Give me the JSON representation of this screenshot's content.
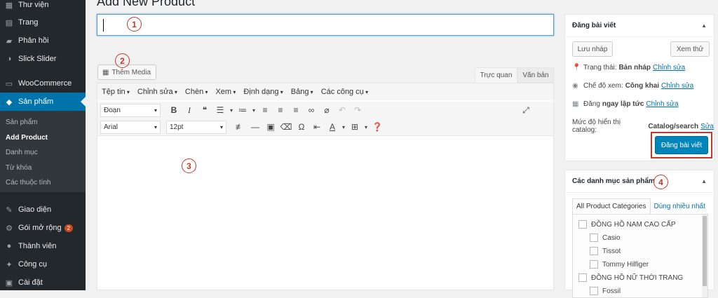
{
  "sidebar": {
    "items_top": [
      {
        "label": "Thư viện",
        "icon": "media-icon"
      },
      {
        "label": "Trang",
        "icon": "page-icon"
      },
      {
        "label": "Phản hồi",
        "icon": "comments-icon"
      },
      {
        "label": "Slick Slider",
        "icon": "slider-icon"
      }
    ],
    "woocommerce": "WooCommerce",
    "products": "Sản phẩm",
    "submenu": [
      "Sản phẩm",
      "Add Product",
      "Danh mục",
      "Từ khóa",
      "Các thuộc tính"
    ],
    "items_bottom": [
      {
        "label": "Giao diện",
        "icon": "appearance-icon"
      },
      {
        "label": "Gói mở rộng",
        "icon": "plugins-icon",
        "badge": "2"
      },
      {
        "label": "Thành viên",
        "icon": "users-icon"
      },
      {
        "label": "Công cụ",
        "icon": "tools-icon"
      },
      {
        "label": "Cài đặt",
        "icon": "settings-icon"
      }
    ]
  },
  "page_title": "Add New Product",
  "annotations": [
    "1",
    "2",
    "3",
    "4"
  ],
  "editor": {
    "add_media": "Thêm Media",
    "tabs": [
      "Trực quan",
      "Văn bản"
    ],
    "menubar": [
      "Tệp tin",
      "Chỉnh sửa",
      "Chèn",
      "Xem",
      "Định dạng",
      "Bảng",
      "Các công cụ"
    ],
    "format_select": "Đoạn",
    "font_select": "Arial",
    "size_select": "12pt"
  },
  "publish": {
    "title": "Đăng bài viết",
    "save_draft": "Lưu nháp",
    "preview": "Xem thử",
    "status_label": "Trạng thái:",
    "status_value": "Bản nháp",
    "visibility_label": "Chế độ xem:",
    "visibility_value": "Công khai",
    "schedule_label": "Đăng",
    "schedule_value": "ngay lập tức",
    "edit": "Chỉnh sửa",
    "catalog_label": "Mức độ hiển thị catalog:",
    "catalog_value": "Catalog/search",
    "catalog_edit": "Sửa",
    "publish_button": "Đăng bài viết"
  },
  "categories": {
    "title": "Các danh mục sản phẩm",
    "tab_all": "All Product Categories",
    "tab_popular": "Dùng nhiều nhất",
    "items": [
      {
        "label": "ĐỒNG HỒ NAM CAO CẤP",
        "level": 0
      },
      {
        "label": "Casio",
        "level": 1
      },
      {
        "label": "Tissot",
        "level": 1
      },
      {
        "label": "Tommy Hilfiger",
        "level": 1
      },
      {
        "label": "ĐỒNG HỒ NỮ THỜI TRANG",
        "level": 0
      },
      {
        "label": "Fossil",
        "level": 1
      }
    ]
  },
  "colors": {
    "admin_bar": "#23282d",
    "accent": "#0073aa",
    "annotation": "#c0392b"
  }
}
